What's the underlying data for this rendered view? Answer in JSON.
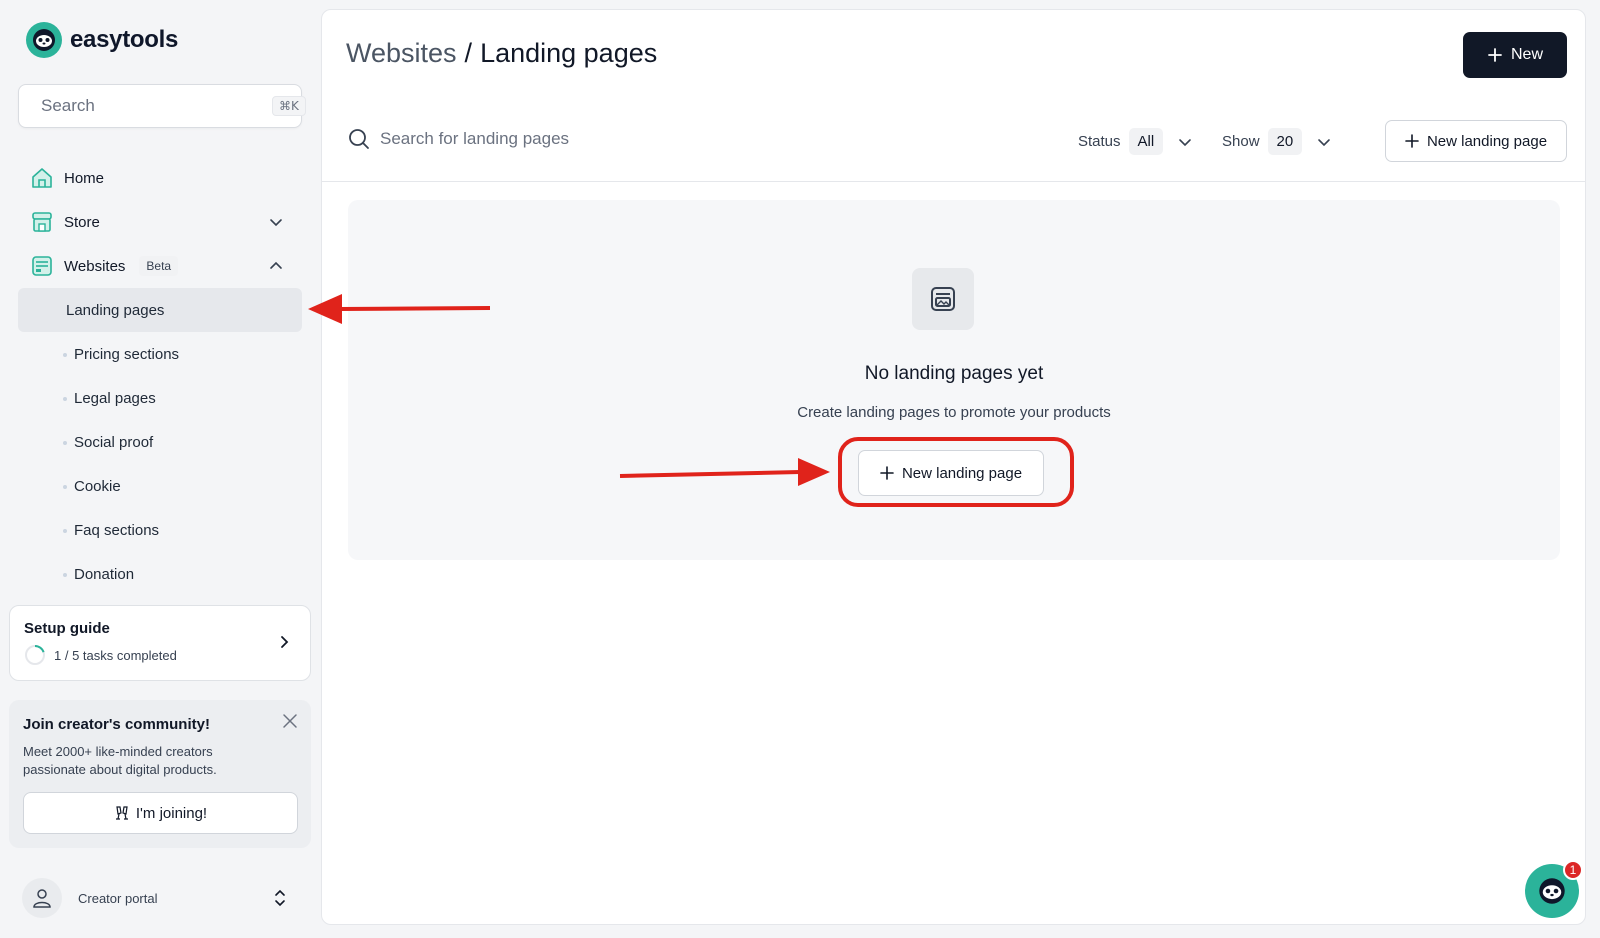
{
  "brand": {
    "name": "easytools",
    "color": "#2bb39a"
  },
  "sidebar": {
    "search": {
      "placeholder": "Search",
      "shortcut": "⌘K"
    },
    "nav": [
      {
        "label": "Home",
        "icon": "home-icon"
      },
      {
        "label": "Store",
        "icon": "store-icon"
      },
      {
        "label": "Websites",
        "icon": "websites-icon",
        "badge": "Beta"
      }
    ],
    "websites_sub": [
      {
        "label": "Landing pages",
        "active": true
      },
      {
        "label": "Pricing sections"
      },
      {
        "label": "Legal pages"
      },
      {
        "label": "Social proof"
      },
      {
        "label": "Cookie"
      },
      {
        "label": "Faq sections"
      },
      {
        "label": "Donation"
      }
    ],
    "setup": {
      "title": "Setup guide",
      "progress": "1 / 5 tasks completed",
      "completed": 1,
      "total": 5
    },
    "community": {
      "title": "Join creator's community!",
      "text": "Meet 2000+ like-minded creators passionate about digital products.",
      "button": "I'm joining!"
    },
    "portal": {
      "label": "Creator portal"
    }
  },
  "header": {
    "breadcrumb_parent": "Websites",
    "breadcrumb_sep": "/",
    "breadcrumb_current": "Landing pages",
    "new_button": "New"
  },
  "toolbar": {
    "search_placeholder": "Search for landing pages",
    "status_label": "Status",
    "status_value": "All",
    "show_label": "Show",
    "show_value": "20",
    "new_button": "New landing page"
  },
  "empty_state": {
    "title": "No landing pages yet",
    "subtitle": "Create landing pages to promote your products",
    "button": "New landing page"
  },
  "chat": {
    "badge_count": "1"
  },
  "colors": {
    "annotation": "#e0231b",
    "primary_button": "#111827"
  }
}
